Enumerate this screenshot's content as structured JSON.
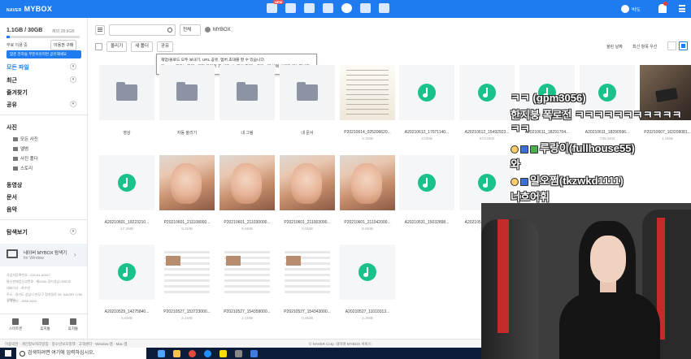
{
  "header": {
    "naver": "NAVER",
    "brand": "MYBOX",
    "new_badge": "NEW",
    "user_name": "박도",
    "bell_count": "1"
  },
  "sidebar": {
    "quota": "1.1GB / 30GB",
    "quota_sub": "제외 28.9GB",
    "used_fraction": 0.04,
    "free_label": "무료 이용 중",
    "upgrade": "이용권 구매",
    "promo": "맞춘 전자들 부진이유러면 공유해세요",
    "nav": [
      "모든 파일",
      "최근",
      "즐겨찾기",
      "공유"
    ],
    "photos_heading": "사진",
    "photo_items": [
      "모든 사진",
      "앨범",
      "사진 폴더",
      "스토리"
    ],
    "more_nav": [
      "동영상",
      "문서",
      "음악"
    ],
    "explore": "탐색보기",
    "sync_title": "네이버 MYBOX 탐색기",
    "sync_sub": "for Window",
    "company_info": [
      "사업자등록번호 : 220-81-62517",
      "통신판매업신고번호 : 제2006-경기성남-0692호",
      "대표이사 : 최수연",
      "주소 : 경기도 성남시 분당구 정자일로 95, NAVER 1784, 13561",
      "고객센터 : 1588-3820"
    ],
    "footer_buttons": [
      "스마트폰",
      "휴지통",
      "휴지통"
    ]
  },
  "toolbar": {
    "scope": "전체",
    "location": "MYBOX",
    "buttons": [
      "올리기",
      "새 폴더",
      "공유"
    ],
    "tooltip_line1": "재업/올로드 모두 보내기, URL 공유, 멤버 초대를 할 수 있습니다.",
    "tooltip_line2": "단, URL 공유는 파일 1개만 올리기 후 선택 시, 멤버 초대는 폴더 1개 선택 시에만 가능합니다.",
    "sort": "올린 날짜",
    "sort2": "최신 항목 우선"
  },
  "files": [
    {
      "name": "영상",
      "size": "",
      "kind": "folder"
    },
    {
      "name": "자동 올리기",
      "size": "",
      "kind": "folder"
    },
    {
      "name": "내 그림",
      "size": "",
      "kind": "folder"
    },
    {
      "name": "내 문서",
      "size": "",
      "kind": "folder"
    },
    {
      "name": "P20210614_025206620...",
      "size": "4.2MB",
      "kind": "paper"
    },
    {
      "name": "A20210612_17071140...",
      "size": "3.0MB",
      "kind": "audio"
    },
    {
      "name": "A20210612_15492923...",
      "size": "973.8KB",
      "kind": "audio"
    },
    {
      "name": "A20210611_18291704...",
      "size": "",
      "kind": "audio"
    },
    {
      "name": "A20210611_18290596...",
      "size": "795.5KB",
      "kind": "audio"
    },
    {
      "name": "P20210607_163209081...",
      "size": "1.6MB",
      "kind": "dark"
    },
    {
      "name": "A20210601_19223210...",
      "size": "17.2MB",
      "kind": "audio"
    },
    {
      "name": "P20210601_211108000...",
      "size": "9.2MB",
      "kind": "skin"
    },
    {
      "name": "P20210601_211030000...",
      "size": "9.6MB",
      "kind": "skin"
    },
    {
      "name": "P20210601_211003000...",
      "size": "9.5MB",
      "kind": "skin"
    },
    {
      "name": "P20210601_211042000...",
      "size": "8.8MB",
      "kind": "skin"
    },
    {
      "name": "A20210531_15032898...",
      "size": "",
      "kind": "audio"
    },
    {
      "name": "A20210531_15023075...",
      "size": "12.5MB",
      "kind": "audio"
    },
    {
      "name": "A20210529_14275840...",
      "size": "5.6MB",
      "kind": "audio"
    },
    {
      "name": "P20210527_153723000...",
      "size": "2.1MB",
      "kind": "screen"
    },
    {
      "name": "P20210527_154359000...",
      "size": "2.1MB",
      "kind": "screen"
    },
    {
      "name": "P20210527_154343000...",
      "size": "0.8MB",
      "kind": "screen"
    },
    {
      "name": "A20210527_11010313...",
      "size": "2.2MB",
      "kind": "audio"
    }
  ],
  "chat": [
    {
      "icons": "",
      "text": "ㅋㅋ (gpm3056)"
    },
    {
      "icons": "",
      "text": "한지붕 폭로전 ㅋㅋㅋㅋㅋㅋㅋㅋㅋㅋㅋ"
    },
    {
      "icons": "",
      "text": "ㅋㅋ"
    },
    {
      "icons": "face blue green",
      "text": "루랑이(fullhouse55)"
    },
    {
      "icons": "",
      "text": "와"
    },
    {
      "icons": "face blue",
      "text": "일오쩜(tkzwkd1111)"
    },
    {
      "icons": "",
      "text": "너흐어휘"
    }
  ],
  "status": {
    "left": "이용약관 · 개인정보처리방침 · 청소년보호정책 · 고객센터 · Window 앱 · Mac 앱",
    "center": "© NAVER Corp.   네이버 MYBOX 서비스"
  },
  "taskbar": {
    "search_placeholder": "검색하려면 여기에 입력하십시오."
  }
}
